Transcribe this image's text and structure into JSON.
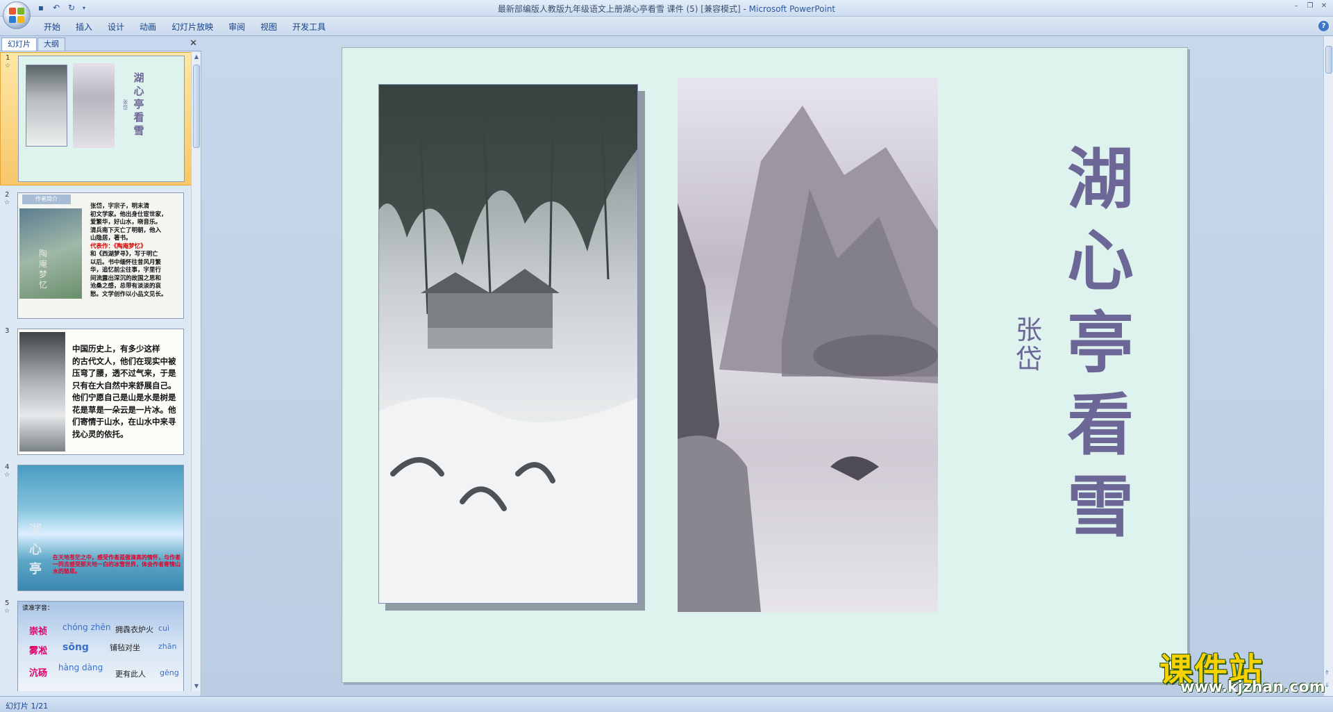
{
  "titlebar": {
    "title": "最新部编版人教版九年级语文上册湖心亭看雪 课件 (5) [兼容模式]",
    "app_name": "Microsoft PowerPoint",
    "separator": " - "
  },
  "ribbon": {
    "tabs": [
      "开始",
      "插入",
      "设计",
      "动画",
      "幻灯片放映",
      "审阅",
      "视图",
      "开发工具"
    ]
  },
  "panel": {
    "tab_slides": "幻灯片",
    "tab_outline": "大纲"
  },
  "thumbnails": [
    {
      "num": "1",
      "title": "湖心亭看雪",
      "author": "张岱"
    },
    {
      "num": "2",
      "tag": "作者简介",
      "cover": "陶庵梦忆",
      "lines": [
        "张岱，字宗子，明末清",
        "初文学家。他出身仕宦世家，",
        "爱繁华，好山水，晓音乐。",
        "清兵南下灭亡了明朝，他入",
        "山隐居，著书。",
        "代表作：《陶庵梦忆》",
        "和《西湖梦寻》，写于明亡",
        "以后。书中缅怀往昔风月繁",
        "华，追忆前尘往事，字里行",
        "间流露出深沉的故国之思和",
        "沧桑之感，总带有淡淡的哀",
        "愁。文学创作以小品文见长。"
      ]
    },
    {
      "num": "3",
      "lines": [
        "中国历史上，有多少这样",
        "的古代文人，他们在现实中被",
        "压弯了腰，透不过气来，于是",
        "只有在大自然中来舒展自己。",
        "他们宁愿自己是山是水是树是",
        "花是草是一朵云是一片冰。他",
        "们寄情于山水，在山水中来寻",
        "找心灵的依托。"
      ]
    },
    {
      "num": "4",
      "title": "湖心亭",
      "note": "在天地苍茫之中，感受作者孤傲清高的情怀，与作者一同去感受那天地一白的冰雪世界，体会作者寄情山水的愁思。"
    },
    {
      "num": "5",
      "heading": "读准字音：",
      "words": [
        {
          "hanzi": "崇祯",
          "pinyin": "chóng zhēn"
        },
        {
          "hanzi": "拥毳衣炉火",
          "pinyin": "cuì"
        },
        {
          "hanzi": "雾凇",
          "pinyin": "sōng"
        },
        {
          "hanzi": "铺毡对坐",
          "pinyin": "zhān"
        },
        {
          "hanzi": "沆砀",
          "pinyin": "hàng dàng"
        },
        {
          "hanzi": "更有此人",
          "pinyin": "gēng"
        }
      ]
    }
  ],
  "slide": {
    "title_chars": [
      "湖",
      "心",
      "亭",
      "看",
      "雪"
    ],
    "author_chars": [
      "张",
      "岱"
    ]
  },
  "watermark": {
    "text": "课件站",
    "url": "www.kjzhan.com"
  },
  "status": {
    "text": "幻灯片 1/21"
  },
  "colors": {
    "slide_bg": "#dff3ee",
    "title_color": "#6c6796",
    "selected_thumb": "#f8c76a"
  }
}
